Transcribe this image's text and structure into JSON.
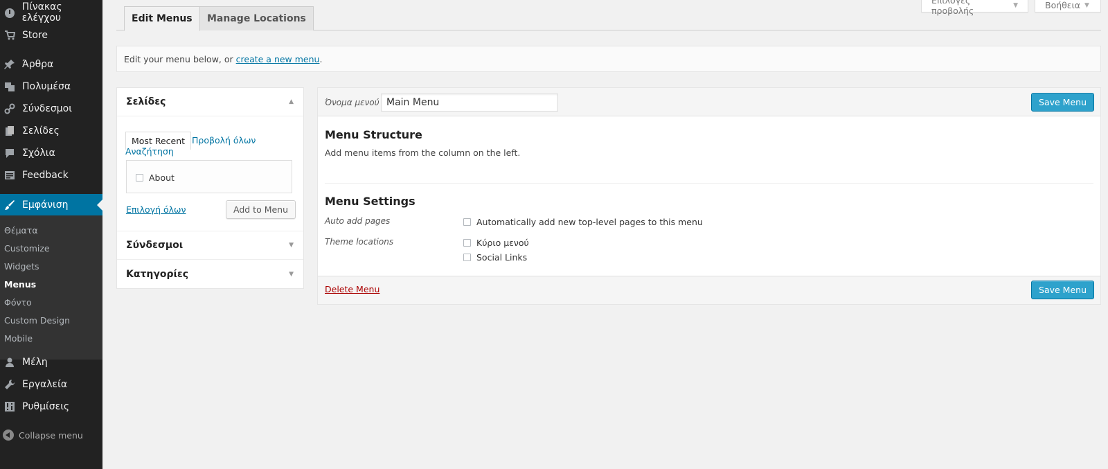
{
  "sidebar": {
    "items": [
      {
        "label": "Πίνακας ελέγχου",
        "icon": "dashboard-icon"
      },
      {
        "label": "Store",
        "icon": "cart-icon"
      },
      {
        "label": "Άρθρα",
        "icon": "pin-icon"
      },
      {
        "label": "Πολυμέσα",
        "icon": "media-icon"
      },
      {
        "label": "Σύνδεσμοι",
        "icon": "link-icon"
      },
      {
        "label": "Σελίδες",
        "icon": "pages-icon"
      },
      {
        "label": "Σχόλια",
        "icon": "comment-icon"
      },
      {
        "label": "Feedback",
        "icon": "feedback-icon"
      },
      {
        "label": "Εμφάνιση",
        "icon": "brush-icon"
      },
      {
        "label": "Μέλη",
        "icon": "user-icon"
      },
      {
        "label": "Εργαλεία",
        "icon": "wrench-icon"
      },
      {
        "label": "Ρυθμίσεις",
        "icon": "settings-icon"
      }
    ],
    "submenu": [
      "Θέματα",
      "Customize",
      "Widgets",
      "Menus",
      "Φόντο",
      "Custom Design",
      "Mobile"
    ],
    "collapse_label": "Collapse menu"
  },
  "screen_options": {
    "label": "Επιλογές προβολής",
    "arrow": "▼"
  },
  "help": {
    "label": "Βοήθεια",
    "arrow": "▼"
  },
  "tabs": {
    "edit": "Edit Menus",
    "manage": "Manage Locations"
  },
  "notice": {
    "text": "Edit your menu below, or",
    "link": "create a new menu",
    "end": "."
  },
  "left": {
    "pages": {
      "title": "Σελίδες",
      "tab_recent": "Most Recent",
      "tab_all": "Προβολή όλων",
      "tab_search": "Αναζήτηση",
      "items": [
        "About"
      ],
      "select_all": "Επιλογή όλων",
      "add_button": "Add to Menu"
    },
    "links_title": "Σύνδεσμοι",
    "categories_title": "Κατηγορίες"
  },
  "editor": {
    "name_label": "Όνομα μενού",
    "name_value": "Main Menu",
    "save_label": "Save Menu",
    "structure_title": "Menu Structure",
    "structure_text": "Add menu items from the column on the left.",
    "settings_title": "Menu Settings",
    "auto_add_label": "Auto add pages",
    "auto_add_option": "Automatically add new top-level pages to this menu",
    "theme_locations_label": "Theme locations",
    "locations": [
      "Κύριο μενού",
      "Social Links"
    ],
    "delete_label": "Delete Menu"
  },
  "colors": {
    "sidebar_bg": "#222222",
    "accent": "#0074a2",
    "primary_button": "#2ea2cc",
    "delete": "#aa0000"
  }
}
